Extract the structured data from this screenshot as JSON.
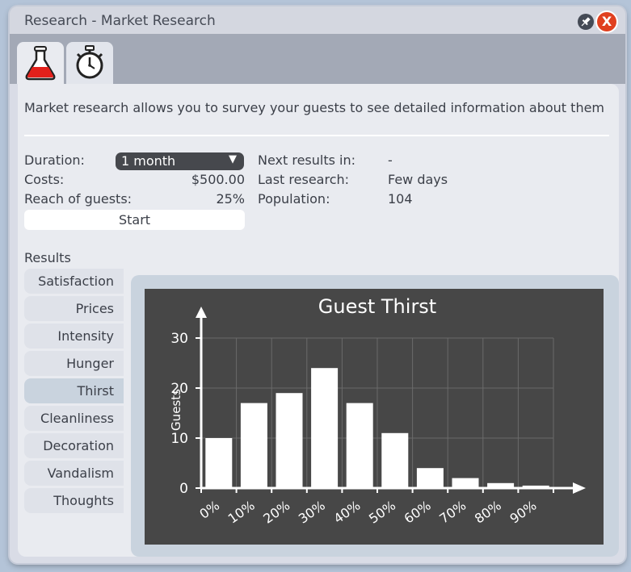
{
  "window": {
    "title": "Research - Market Research",
    "pin_icon": "pin-icon",
    "close_icon": "close-icon",
    "close_glyph": "X"
  },
  "tabs": [
    {
      "icon": "flask-icon",
      "active": true
    },
    {
      "icon": "stopwatch-icon",
      "active": false
    }
  ],
  "description": "Market research allows you to survey your guests to see detailed information about them",
  "settings": {
    "duration_label": "Duration:",
    "duration_value": "1 month",
    "costs_label": "Costs:",
    "costs_value": "$500.00",
    "reach_label": "Reach of guests:",
    "reach_value": "25%",
    "start_label": "Start",
    "next_label": "Next results in:",
    "next_value": "-",
    "last_label": "Last research:",
    "last_value": "Few days",
    "population_label": "Population:",
    "population_value": "104"
  },
  "results": {
    "title": "Results",
    "items": [
      "Satisfaction",
      "Prices",
      "Intensity",
      "Hunger",
      "Thirst",
      "Cleanliness",
      "Decoration",
      "Vandalism",
      "Thoughts"
    ],
    "selected": "Thirst"
  },
  "chart_data": {
    "type": "bar",
    "title": "Guest Thirst",
    "ylabel": "Guests",
    "xlabel": "",
    "categories": [
      "0%",
      "10%",
      "20%",
      "30%",
      "40%",
      "50%",
      "60%",
      "70%",
      "80%",
      "90%"
    ],
    "values": [
      10,
      17,
      19,
      24,
      17,
      11,
      4,
      2,
      1,
      0.5
    ],
    "ylim": [
      0,
      30
    ],
    "yticks": [
      0,
      10,
      20,
      30
    ],
    "grid": true,
    "colors": {
      "background": "#474747",
      "bars": "#ffffff",
      "grid": "#6a6a6a",
      "text": "#ffffff"
    }
  }
}
